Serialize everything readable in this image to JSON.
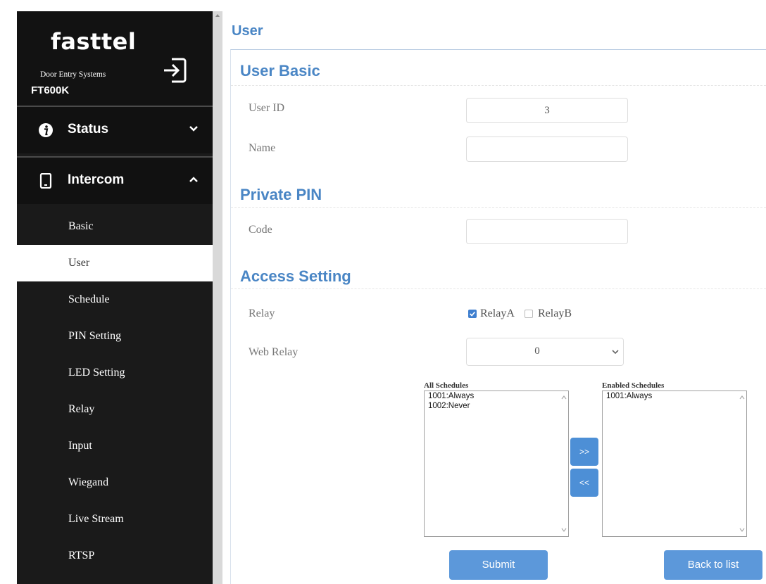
{
  "sidebar": {
    "brand": "fasttel",
    "tagline": "Door Entry Systems",
    "model": "FT600K",
    "logout_icon": "logout-icon",
    "menus": [
      {
        "label": "Status",
        "icon": "info-icon",
        "state": "collapsed"
      },
      {
        "label": "Intercom",
        "icon": "phone-icon",
        "state": "expanded"
      }
    ],
    "items": [
      "Basic",
      "User",
      "Schedule",
      "PIN Setting",
      "LED Setting",
      "Relay",
      "Input",
      "Wiegand",
      "Live Stream",
      "RTSP"
    ],
    "active_item": "User"
  },
  "page": {
    "title": "User"
  },
  "user_basic": {
    "title": "User Basic",
    "user_id_label": "User ID",
    "user_id_value": "3",
    "name_label": "Name",
    "name_value": ""
  },
  "private_pin": {
    "title": "Private PIN",
    "code_label": "Code",
    "code_value": ""
  },
  "access": {
    "title": "Access Setting",
    "relay_label": "Relay",
    "relay_a": {
      "label": "RelayA",
      "checked": true
    },
    "relay_b": {
      "label": "RelayB",
      "checked": false
    },
    "web_relay_label": "Web Relay",
    "web_relay_value": "0"
  },
  "schedules": {
    "all_label": "All Schedules",
    "all": [
      "1001:Always",
      "1002:Never"
    ],
    "enabled_label": "Enabled Schedules",
    "enabled": [
      "1001:Always"
    ],
    "add_label": ">>",
    "remove_label": "<<"
  },
  "actions": {
    "submit": "Submit",
    "back": "Back to list"
  },
  "colors": {
    "accent": "#4a86c5",
    "button": "#5c98da",
    "sidebar_bg": "#1a1a1a"
  }
}
